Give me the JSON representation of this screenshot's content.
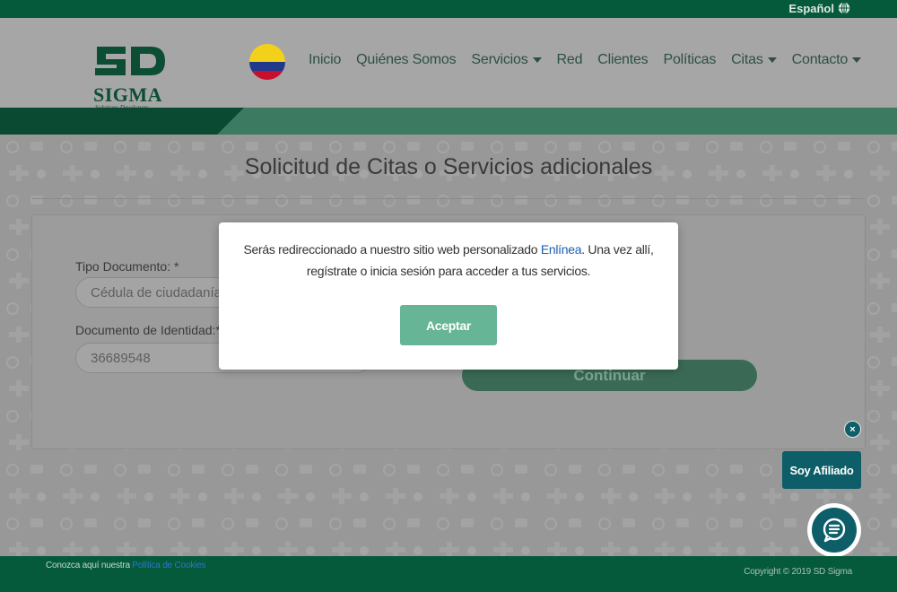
{
  "topbar": {
    "language_label": "Español",
    "globe_icon": "globe-icon"
  },
  "header": {
    "logo_mark": "SD",
    "logo_name": "SIGMA",
    "logo_tagline": "Solutions Developers",
    "flag_icon": "colombia-flag-icon",
    "nav": [
      {
        "label": "Inicio",
        "dropdown": false
      },
      {
        "label": "Quiénes Somos",
        "dropdown": false
      },
      {
        "label": "Servicios",
        "dropdown": true
      },
      {
        "label": "Red",
        "dropdown": false
      },
      {
        "label": "Clientes",
        "dropdown": false
      },
      {
        "label": "Políticas",
        "dropdown": false
      },
      {
        "label": "Citas",
        "dropdown": true
      },
      {
        "label": "Contacto",
        "dropdown": true
      }
    ]
  },
  "page": {
    "title": "Solicitud de Citas o Servicios adicionales",
    "form": {
      "doc_type_label": "Tipo Documento: *",
      "doc_type_value": "Cédula de ciudadanía",
      "doc_id_label": "Documento de Identidad:*",
      "doc_id_value": "36689548",
      "continue_label": "Continuar"
    }
  },
  "modal": {
    "text_before": "Serás redireccionado a nuestro sitio web personalizado ",
    "link_text": "Enlínea",
    "text_after": ". Una vez allí, regístrate o inicia sesión para acceder a tus servicios.",
    "accept_label": "Aceptar"
  },
  "widgets": {
    "close_symbol": "×",
    "affiliate_label": "Soy Afiliado",
    "chat_icon": "chat-icon"
  },
  "footer": {
    "cookies_text": "Conozca aquí nuestra ",
    "cookies_link": "Política de Cookies",
    "copyright": "Copyright © 2019 SD Sigma"
  },
  "colors": {
    "brand_dark_green": "#055a3b",
    "accent_green": "#66b596",
    "teal": "#0d5e68",
    "link_blue": "#1a5fb4"
  }
}
